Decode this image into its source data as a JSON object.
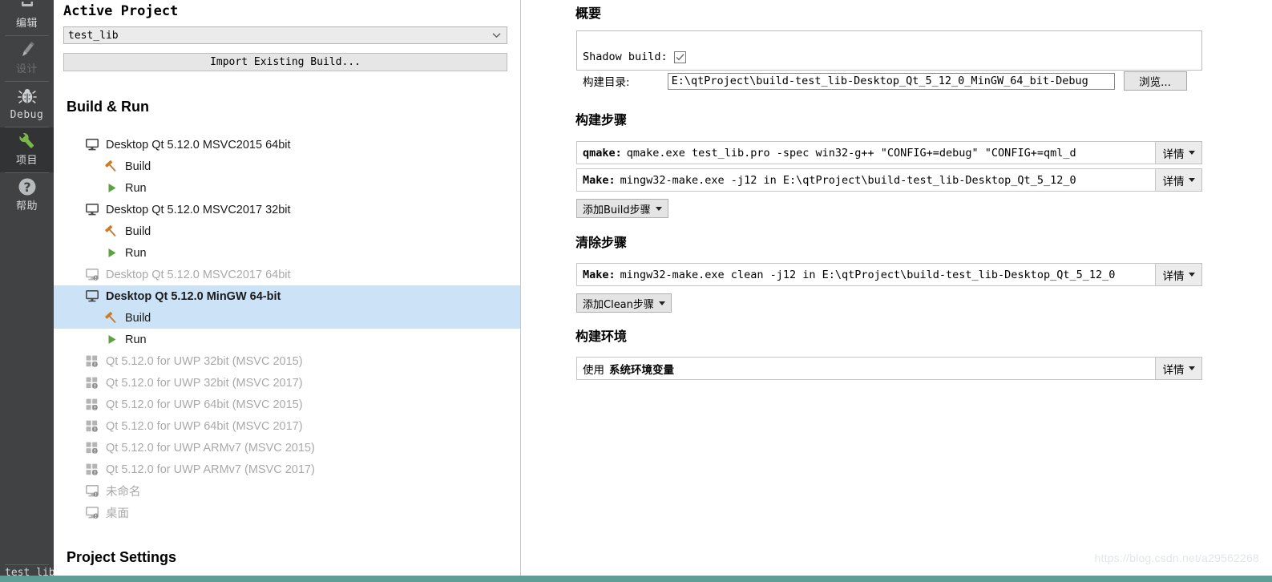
{
  "modebar": {
    "items": [
      {
        "label": "编辑",
        "icon": "edit-icon",
        "state": "normal",
        "latin": false
      },
      {
        "label": "设计",
        "icon": "design-pencil-icon",
        "state": "dim",
        "latin": false
      },
      {
        "label": "Debug",
        "icon": "debug-bug-icon",
        "state": "normal",
        "latin": true
      },
      {
        "label": "项目",
        "icon": "projects-wrench-icon",
        "state": "active",
        "latin": false
      },
      {
        "label": "帮助",
        "icon": "help-question-icon",
        "state": "normal",
        "latin": false
      }
    ],
    "footer_label": "test_lib"
  },
  "left": {
    "active_project_title": "Active Project",
    "project_combo_value": "test_lib",
    "import_button_label": "Import Existing Build...",
    "build_run_title": "Build & Run",
    "project_settings_title": "Project Settings",
    "tree": [
      {
        "label": "Desktop Qt 5.12.0 MSVC2015 64bit",
        "icon": "desktop-monitor-icon",
        "level": "kit",
        "state": "normal"
      },
      {
        "label": "Build",
        "icon": "hammer-icon",
        "level": "leaf",
        "state": "normal"
      },
      {
        "label": "Run",
        "icon": "play-triangle-icon",
        "level": "leaf",
        "state": "normal"
      },
      {
        "label": "Desktop Qt 5.12.0 MSVC2017 32bit",
        "icon": "desktop-monitor-icon",
        "level": "kit",
        "state": "normal"
      },
      {
        "label": "Build",
        "icon": "hammer-icon",
        "level": "leaf",
        "state": "normal"
      },
      {
        "label": "Run",
        "icon": "play-triangle-icon",
        "level": "leaf",
        "state": "normal"
      },
      {
        "label": "Desktop Qt 5.12.0 MSVC2017 64bit",
        "icon": "desktop-monitor-warning-icon",
        "level": "kit",
        "state": "disabled"
      },
      {
        "label": "Desktop Qt 5.12.0 MinGW 64-bit",
        "icon": "desktop-monitor-icon",
        "level": "kit",
        "state": "selected-bold"
      },
      {
        "label": "Build",
        "icon": "hammer-icon",
        "level": "leaf",
        "state": "selected"
      },
      {
        "label": "Run",
        "icon": "play-triangle-icon",
        "level": "leaf",
        "state": "normal"
      },
      {
        "label": "Qt 5.12.0 for UWP 32bit (MSVC 2015)",
        "icon": "uwp-warning-icon",
        "level": "kit",
        "state": "disabled"
      },
      {
        "label": "Qt 5.12.0 for UWP 32bit (MSVC 2017)",
        "icon": "uwp-warning-icon",
        "level": "kit",
        "state": "disabled"
      },
      {
        "label": "Qt 5.12.0 for UWP 64bit (MSVC 2015)",
        "icon": "uwp-warning-icon",
        "level": "kit",
        "state": "disabled"
      },
      {
        "label": "Qt 5.12.0 for UWP 64bit (MSVC 2017)",
        "icon": "uwp-warning-icon",
        "level": "kit",
        "state": "disabled"
      },
      {
        "label": "Qt 5.12.0 for UWP ARMv7 (MSVC 2015)",
        "icon": "uwp-warning-icon",
        "level": "kit",
        "state": "disabled"
      },
      {
        "label": "Qt 5.12.0 for UWP ARMv7 (MSVC 2017)",
        "icon": "uwp-warning-icon",
        "level": "kit",
        "state": "disabled"
      },
      {
        "label": "未命名",
        "icon": "desktop-monitor-warning-icon",
        "level": "kit",
        "state": "disabled"
      },
      {
        "label": "桌面",
        "icon": "desktop-monitor-warning-icon",
        "level": "kit",
        "state": "disabled"
      }
    ]
  },
  "right": {
    "summary": {
      "title": "概要",
      "shadow_build_label": "Shadow build:",
      "shadow_build_checked": true,
      "build_dir_label": "构建目录:",
      "build_dir_value": "E:\\qtProject\\build-test_lib-Desktop_Qt_5_12_0_MinGW_64_bit-Debug",
      "browse_button_label": "浏览..."
    },
    "build_steps": {
      "title": "构建步骤",
      "steps": [
        {
          "prefix": "qmake:",
          "text": "qmake.exe test_lib.pro -spec win32-g++ \"CONFIG+=debug\" \"CONFIG+=qml_d",
          "detail_label": "详情"
        },
        {
          "prefix": "Make:",
          "text": "mingw32-make.exe -j12 in E:\\qtProject\\build-test_lib-Desktop_Qt_5_12_0",
          "detail_label": "详情"
        }
      ],
      "add_button_label": "添加Build步骤"
    },
    "clean_steps": {
      "title": "清除步骤",
      "steps": [
        {
          "prefix": "Make:",
          "text": "mingw32-make.exe clean -j12 in E:\\qtProject\\build-test_lib-Desktop_Qt_5_12_0",
          "detail_label": "详情"
        }
      ],
      "add_button_label": "添加Clean步骤"
    },
    "build_env": {
      "title": "构建环境",
      "prefix": "使用",
      "value": "系统环境变量",
      "detail_label": "详情"
    }
  },
  "watermark": "https://blog.csdn.net/a29562268",
  "colors": {
    "modebar_bg": "#404244",
    "modebar_active_bg": "#313335",
    "selection_blue": "#cce3f7",
    "hammer_orange": "#d4741e",
    "run_green": "#5ca33c",
    "wrench_green": "#7ab648",
    "bottom_bar_teal": "#5f9e96"
  }
}
